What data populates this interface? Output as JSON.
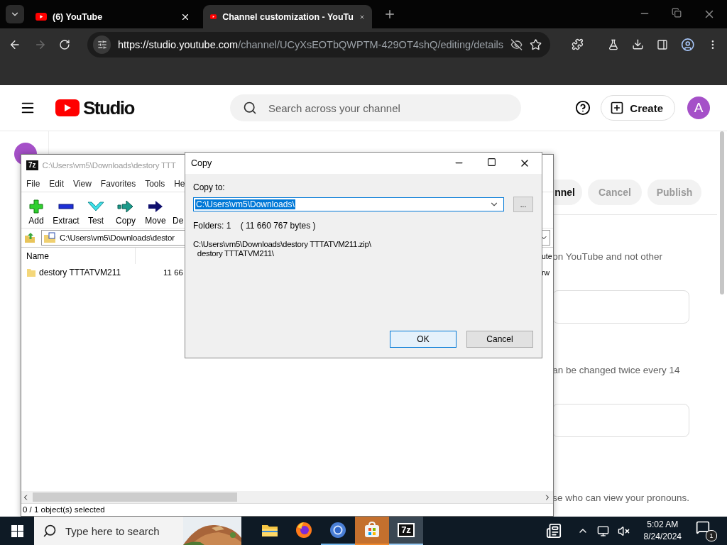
{
  "browser": {
    "tabs": [
      {
        "title": "(6) YouTube",
        "selected": false
      },
      {
        "title": "Channel customization - YouTu",
        "selected": true
      }
    ],
    "forward_disabled": true,
    "url_host": "https://studio.youtube.com",
    "url_path": "/channel/UCyXsEOTbQWPTM-429OT4shQ/editing/details"
  },
  "studio": {
    "logo": "Studio",
    "search_placeholder": "Search across your channel",
    "create_button": "Create",
    "avatar": "A",
    "actions": [
      {
        "label": "nnel",
        "disabled": false
      },
      {
        "label": "Cancel",
        "disabled": true
      },
      {
        "label": "Publish",
        "disabled": true
      }
    ],
    "content": [
      {
        "kind": "text",
        "text": "on YouTube and not other"
      },
      {
        "kind": "field"
      },
      {
        "kind": "text",
        "text": "an be changed twice every 14"
      },
      {
        "kind": "field"
      },
      {
        "kind": "text",
        "text": "se who can view your pronouns."
      }
    ]
  },
  "sevenzip": {
    "icon_text": "7z",
    "title": "C:\\Users\\vm5\\Downloads\\destory TTT",
    "menu": [
      "File",
      "Edit",
      "View",
      "Favorites",
      "Tools",
      "He"
    ],
    "toolbar": [
      {
        "label": "Add",
        "kind": "add"
      },
      {
        "label": "Extract",
        "kind": "extract"
      },
      {
        "label": "Test",
        "kind": "test"
      },
      {
        "label": "Copy",
        "kind": "copy"
      },
      {
        "label": "Move",
        "kind": "move"
      },
      {
        "label": "De",
        "kind": "delete"
      }
    ],
    "address": "C:\\Users\\vm5\\Downloads\\destor",
    "columns": [
      "Name"
    ],
    "column_last": "ute",
    "rows": [
      {
        "name": "destory TTTATVM211",
        "size": "11 66",
        "last": "rw"
      }
    ],
    "status": "0 / 1 object(s) selected"
  },
  "copy_dialog": {
    "title": "Copy",
    "label": "Copy to:",
    "value": "C:\\Users\\vm5\\Downloads\\",
    "value_selected": true,
    "browse": "...",
    "info": "Folders: 1    ( 11 660 767 bytes )",
    "source": [
      "C:\\Users\\vm5\\Downloads\\destory TTTATVM211.zip\\",
      "destory TTTATVM211\\"
    ],
    "buttons": [
      {
        "label": "OK",
        "focused": true
      },
      {
        "label": "Cancel",
        "focused": false
      }
    ]
  },
  "taskbar": {
    "search_placeholder": "Type here to search",
    "apps": [
      {
        "kind": "explorer",
        "running": false,
        "active": false,
        "attention": false
      },
      {
        "kind": "firefox",
        "running": false,
        "active": false,
        "attention": false
      },
      {
        "kind": "chrome",
        "running": true,
        "active": false,
        "attention": false
      },
      {
        "kind": "store",
        "running": true,
        "active": false,
        "attention": true
      },
      {
        "kind": "sevenzip",
        "running": true,
        "active": true,
        "attention": false,
        "label": "7z"
      }
    ],
    "time": "5:02 AM",
    "date": "8/24/2024",
    "notifications": "1"
  }
}
